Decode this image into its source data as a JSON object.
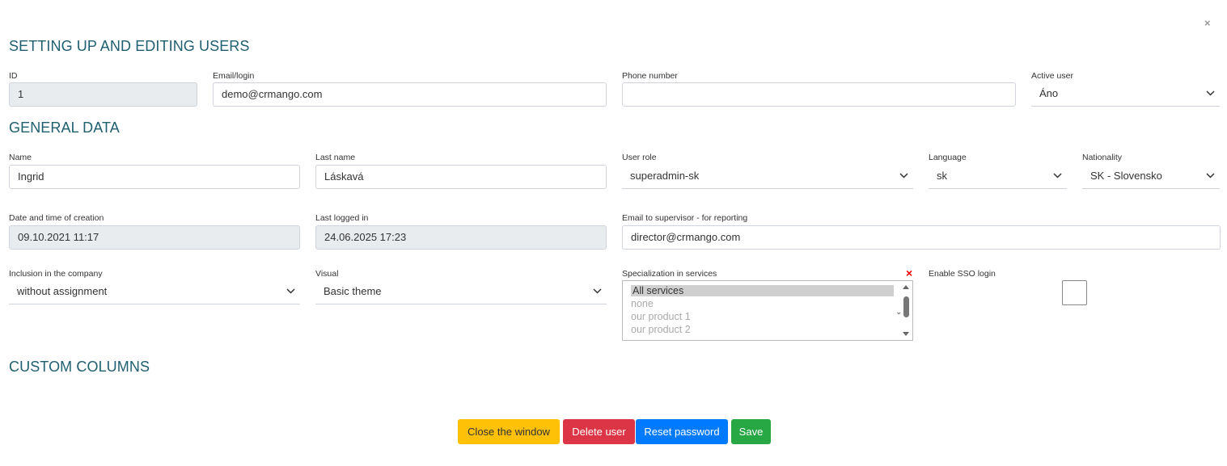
{
  "window": {
    "close_glyph": "×"
  },
  "sections": {
    "setup": "SETTING UP AND EDITING USERS",
    "general": "GENERAL DATA",
    "custom": "CUSTOM COLUMNS"
  },
  "fields": {
    "id": {
      "label": "ID",
      "value": "1"
    },
    "email": {
      "label": "Email/login",
      "value": "demo@crmango.com"
    },
    "phone": {
      "label": "Phone number",
      "value": ""
    },
    "active": {
      "label": "Active user",
      "value": "Áno"
    },
    "name": {
      "label": "Name",
      "value": "Ingrid"
    },
    "lastname": {
      "label": "Last name",
      "value": "Láskavá"
    },
    "role": {
      "label": "User role",
      "value": "superadmin-sk"
    },
    "language": {
      "label": "Language",
      "value": "sk"
    },
    "nationality": {
      "label": "Nationality",
      "value": "SK - Slovensko"
    },
    "created": {
      "label": "Date and time of creation",
      "value": "09.10.2021 11:17"
    },
    "lastlogin": {
      "label": "Last logged in",
      "value": "24.06.2025 17:23"
    },
    "supervisor": {
      "label": "Email to supervisor - for reporting",
      "value": "director@crmango.com"
    },
    "company": {
      "label": "Inclusion in the company",
      "value": "without assignment"
    },
    "visual": {
      "label": "Visual",
      "value": "Basic theme"
    },
    "specialization": {
      "label": "Specialization in services",
      "options": [
        "All services",
        "none",
        "our product 1",
        "our product 2"
      ],
      "selected": "All services",
      "clear_glyph": "×"
    },
    "sso": {
      "label": "Enable SSO login",
      "checked": false
    }
  },
  "buttons": {
    "close": "Close the window",
    "delete": "Delete user",
    "reset": "Reset password",
    "save": "Save"
  },
  "colors": {
    "heading": "#1f5f70",
    "close_btn": "#ffc107",
    "delete_btn": "#dc3545",
    "reset_btn": "#007bff",
    "save_btn": "#28a745"
  }
}
